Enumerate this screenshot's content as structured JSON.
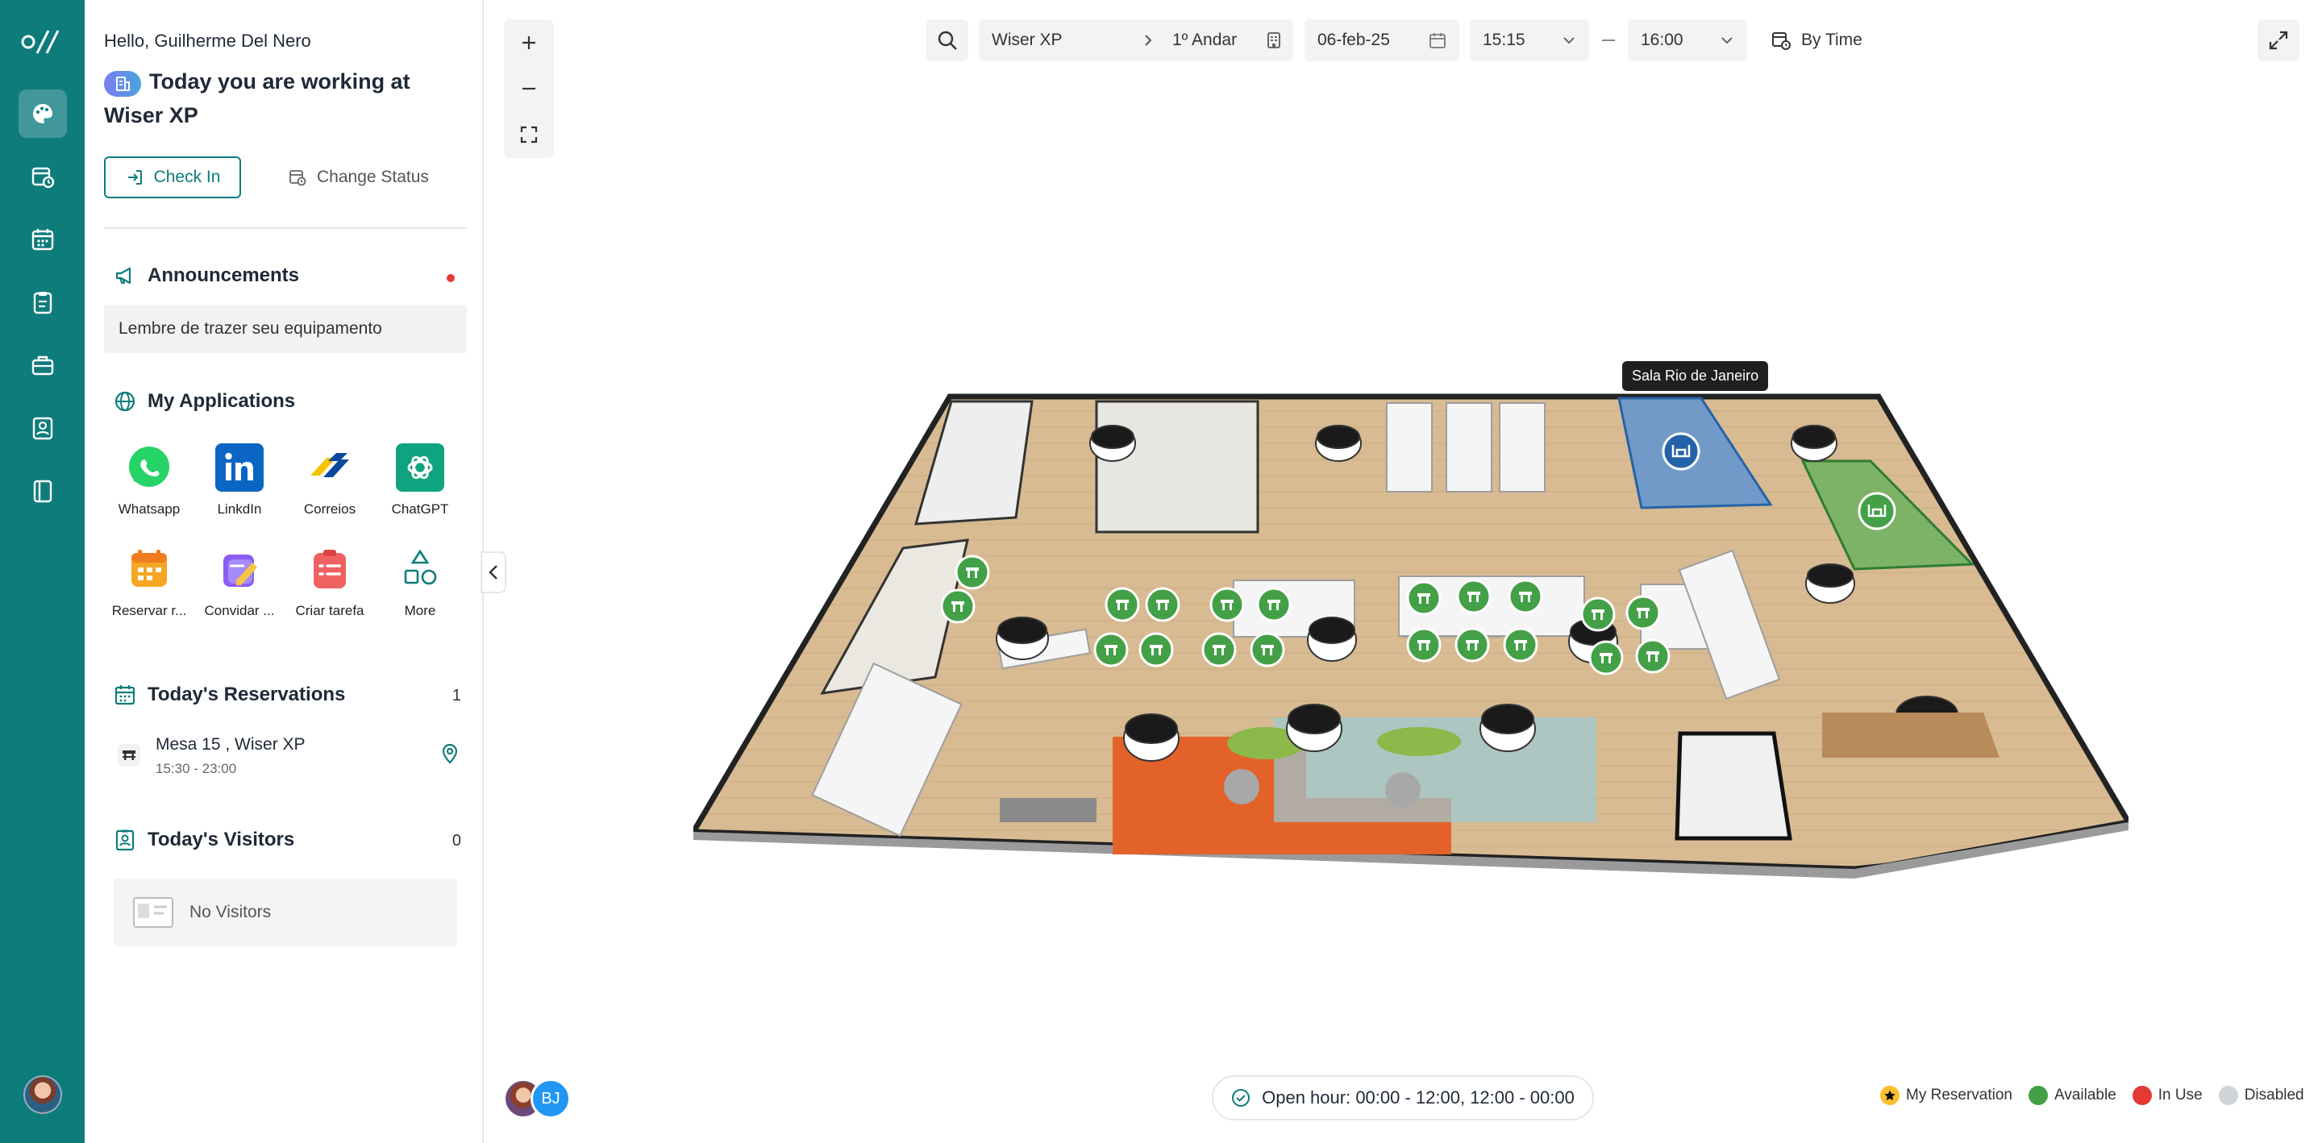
{
  "user": {
    "greeting": "Hello, Guilherme Del Nero",
    "working_at": "Today you are working at Wiser XP"
  },
  "actions": {
    "check_in": "Check In",
    "change_status": "Change Status"
  },
  "announcements": {
    "title": "Announcements",
    "message": "Lembre de trazer seu equipamento"
  },
  "applications": {
    "title": "My Applications",
    "items": [
      {
        "label": "Whatsapp",
        "icon": "whatsapp-icon",
        "color": "#25d366"
      },
      {
        "label": "LinkdIn",
        "icon": "linkedin-icon",
        "color": "#0a66c2"
      },
      {
        "label": "Correios",
        "icon": "correios-icon",
        "color": "#f5c400"
      },
      {
        "label": "ChatGPT",
        "icon": "chatgpt-icon",
        "color": "#10a37f"
      },
      {
        "label": "Reservar r...",
        "icon": "calendar-app-icon",
        "color": "#f5a623"
      },
      {
        "label": "Convidar ...",
        "icon": "invite-app-icon",
        "color": "#8b5cf6"
      },
      {
        "label": "Criar tarefa",
        "icon": "task-app-icon",
        "color": "#f06262"
      },
      {
        "label": "More",
        "icon": "shapes-icon",
        "color": "#0e7c7b"
      }
    ]
  },
  "reservations": {
    "title": "Today's Reservations",
    "count": "1",
    "items": [
      {
        "name": "Mesa 15 , Wiser XP",
        "time": "15:30 - 23:00"
      }
    ]
  },
  "visitors": {
    "title": "Today's Visitors",
    "count": "0",
    "empty": "No Visitors"
  },
  "filters": {
    "building": "Wiser XP",
    "floor": "1º Andar",
    "date": "06-feb-25",
    "start_time": "15:15",
    "end_time": "16:00",
    "mode": "By Time"
  },
  "map": {
    "tooltip": "Sala Rio de Janeiro",
    "open_hour": "Open hour: 00:00 - 12:00, 12:00 - 00:00"
  },
  "people": {
    "initials": "BJ"
  },
  "legend": [
    {
      "label": "My Reservation",
      "color": "#fbc02d"
    },
    {
      "label": "Available",
      "color": "#43a047"
    },
    {
      "label": "In Use",
      "color": "#e53935"
    },
    {
      "label": "Disabled",
      "color": "#d0d3d8"
    }
  ],
  "colors": {
    "brand": "#0e7c7b",
    "available": "#43a047",
    "room_selected": "#3b82d6"
  }
}
